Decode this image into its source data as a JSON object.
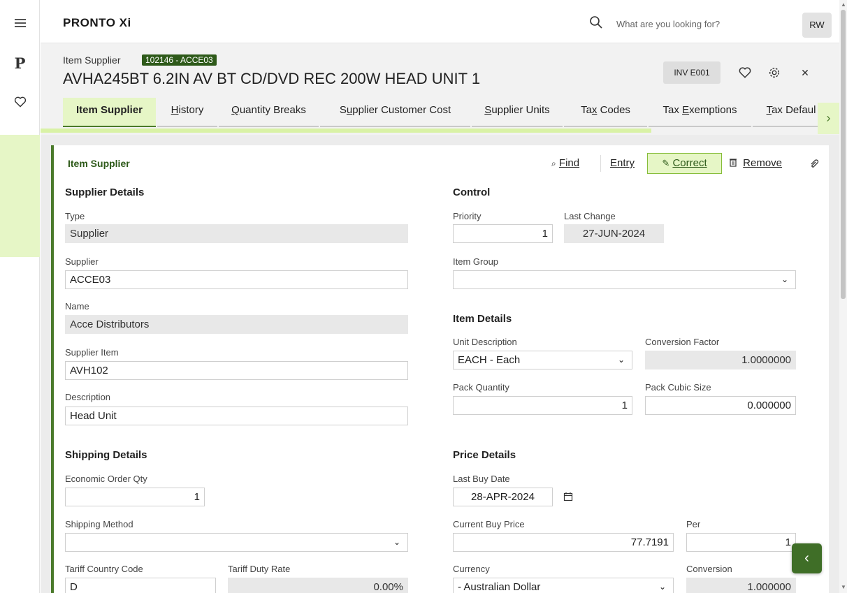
{
  "app": {
    "brand": "PRONTO Xi",
    "user_initials": "RW"
  },
  "search": {
    "placeholder": "What are you looking for?"
  },
  "header": {
    "label": "Item Supplier",
    "badge": "102146 - ACCE03",
    "title": "AVHA245BT 6.2IN AV BT CD/DVD REC 200W HEAD UNIT 1",
    "inv_button": "INV E001"
  },
  "tabs": [
    {
      "pre": "",
      "u": "",
      "post": "Item Supplier"
    },
    {
      "pre": "",
      "u": "H",
      "post": "istory"
    },
    {
      "pre": "",
      "u": "Q",
      "post": "uantity Breaks"
    },
    {
      "pre": "S",
      "u": "u",
      "post": "pplier Customer Cost"
    },
    {
      "pre": "",
      "u": "S",
      "post": "upplier Units"
    },
    {
      "pre": "Ta",
      "u": "x",
      "post": " Codes"
    },
    {
      "pre": "Tax ",
      "u": "E",
      "post": "xemptions"
    },
    {
      "pre": "",
      "u": "T",
      "post": "ax Defaul"
    }
  ],
  "panel": {
    "title": "Item Supplier",
    "find": "Find",
    "entry": "Entry",
    "correct": "Correct",
    "remove": "Remove"
  },
  "supplier_details": {
    "title": "Supplier Details",
    "type_label": "Type",
    "type_value": "Supplier",
    "supplier_label": "Supplier",
    "supplier_value": "ACCE03",
    "name_label": "Name",
    "name_value": "Acce Distributors",
    "supplier_item_label": "Supplier Item",
    "supplier_item_value": "AVH102",
    "description_label": "Description",
    "description_value": "Head Unit"
  },
  "control": {
    "title": "Control",
    "priority_label": "Priority",
    "priority_value": "1",
    "last_change_label": "Last Change",
    "last_change_value": "27-JUN-2024",
    "item_group_label": "Item Group",
    "item_group_value": ""
  },
  "item_details": {
    "title": "Item Details",
    "unit_desc_label": "Unit Description",
    "unit_desc_value": "EACH - Each",
    "conv_factor_label": "Conversion Factor",
    "conv_factor_value": "1.0000000",
    "pack_qty_label": "Pack Quantity",
    "pack_qty_value": "1",
    "pack_cubic_label": "Pack Cubic Size",
    "pack_cubic_value": "0.000000"
  },
  "shipping_details": {
    "title": "Shipping Details",
    "eoq_label": "Economic Order Qty",
    "eoq_value": "1",
    "ship_method_label": "Shipping Method",
    "ship_method_value": "",
    "tariff_country_label": "Tariff Country Code",
    "tariff_country_value": "D",
    "tariff_duty_label": "Tariff Duty Rate",
    "tariff_duty_value": "0.00%"
  },
  "price_details": {
    "title": "Price Details",
    "last_buy_date_label": "Last Buy Date",
    "last_buy_date_value": "28-APR-2024",
    "current_buy_price_label": "Current Buy Price",
    "current_buy_price_value": "77.7191",
    "per_label": "Per",
    "per_value": "1",
    "currency_label": "Currency",
    "currency_value": "- Australian Dollar",
    "conversion_label": "Conversion",
    "conversion_value": "1.000000"
  },
  "colors": {
    "accent_green": "#4a7a2a",
    "light_green": "#e6f6c6",
    "badge_green": "#2e5a1a"
  }
}
